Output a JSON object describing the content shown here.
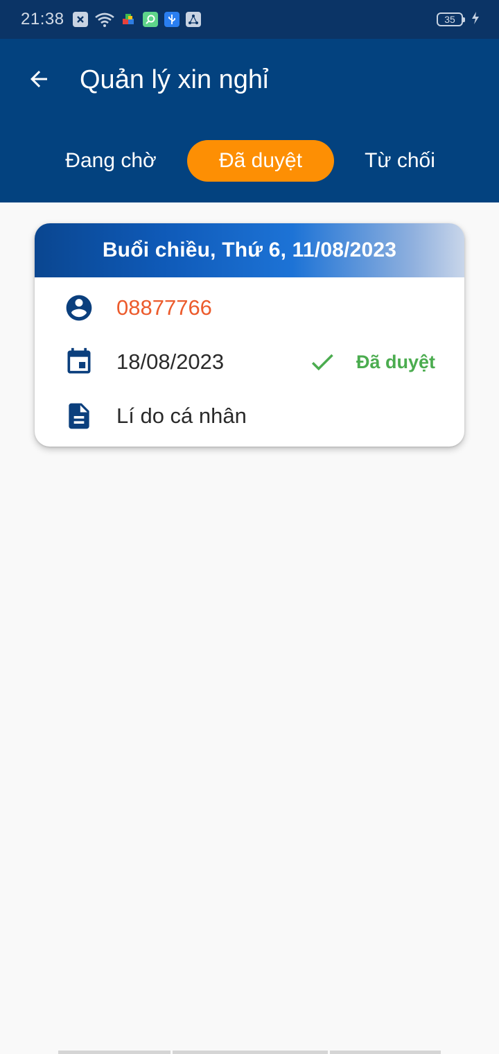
{
  "status_bar": {
    "time": "21:38",
    "battery": "35",
    "icons": [
      "close-box-icon",
      "wifi-icon",
      "puzzle-icon",
      "link-icon",
      "usb-icon",
      "share-icon",
      "charging-icon"
    ]
  },
  "app_bar": {
    "title": "Quản lý xin nghỉ",
    "back_icon": "arrow-back-icon"
  },
  "tabs": [
    {
      "label": "Đang chờ",
      "selected": false
    },
    {
      "label": "Đã duyệt",
      "selected": true
    },
    {
      "label": "Từ chối",
      "selected": false
    }
  ],
  "colors": {
    "app_bar": "#03427f",
    "status_bar": "#0b3466",
    "tab_selected": "#fd8f04",
    "employee_id": "#ec5b2c",
    "approved": "#4bac4f",
    "icon": "#0b3f7d"
  },
  "requests": [
    {
      "title": "Buổi chiều, Thứ 6, 11/08/2023",
      "employee_id": "08877766",
      "date": "18/08/2023",
      "status": "Đã duyệt",
      "reason": "Lí do cá nhân"
    }
  ]
}
